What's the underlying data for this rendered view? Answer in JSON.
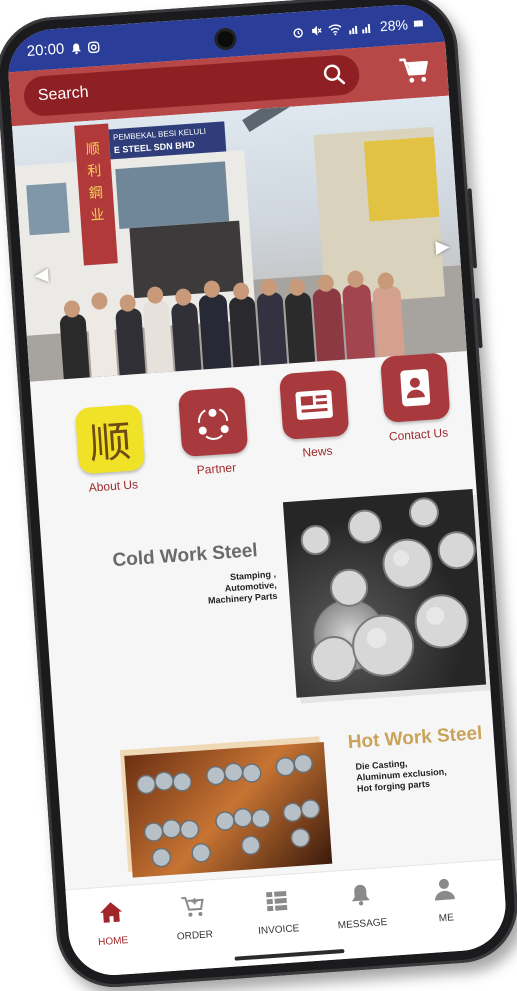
{
  "status_bar": {
    "time": "20:00",
    "battery": "28%"
  },
  "header": {
    "search_placeholder": "Search",
    "search_icon": "search-icon",
    "cart_icon": "cart-icon"
  },
  "hero": {
    "sign_line1": "PEMBEKAL BESI KELULI",
    "sign_line2": "E STEEL SDN BHD",
    "logo_chars": "顺 利 鋼 业"
  },
  "menu": [
    {
      "label": "About Us",
      "icon": "shun-logo-icon"
    },
    {
      "label": "Partner",
      "icon": "partner-icon"
    },
    {
      "label": "News",
      "icon": "news-icon"
    },
    {
      "label": "Contact Us",
      "icon": "contact-icon"
    }
  ],
  "cold_work": {
    "title": "Cold Work Steel",
    "subtitle": [
      "Stamping ,",
      "Automotive,",
      "Machinery Parts"
    ]
  },
  "hot_work": {
    "title": "Hot Work Steel",
    "subtitle": [
      "Die Casting,",
      "Aluminum exclusion,",
      "Hot forging parts"
    ]
  },
  "bottom_nav": [
    {
      "label": "HOME",
      "icon": "home-icon",
      "active": true
    },
    {
      "label": "ORDER",
      "icon": "add-cart-icon",
      "active": false
    },
    {
      "label": "INVOICE",
      "icon": "invoice-icon",
      "active": false
    },
    {
      "label": "MESSAGE",
      "icon": "bell-icon",
      "active": false
    },
    {
      "label": "ME",
      "icon": "person-icon",
      "active": false
    }
  ],
  "colors": {
    "status_bar": "#2a3e99",
    "header": "#b84848",
    "search_bg": "#8e1f23",
    "menu_icon_bg": "#a83a3d",
    "about_icon_bg": "#f0e327",
    "hot_title": "#c9a45a",
    "nav_active": "#a0262b"
  }
}
